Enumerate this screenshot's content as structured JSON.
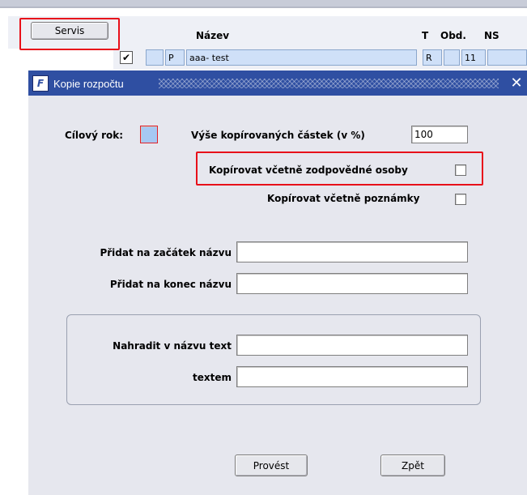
{
  "background_form": {
    "servis_button": "Servis",
    "columns": {
      "nazev": "Název",
      "t": "T",
      "obd": "Obd.",
      "ns": "NS"
    },
    "row": {
      "checked": "✔",
      "type_code": "P",
      "name": "aaa- test",
      "t_value": "R",
      "obd_value": "11"
    }
  },
  "dialog": {
    "title": "Kopie rozpočtu",
    "app_icon": "F",
    "close": "✕",
    "target_year_label": "Cílový rok:",
    "target_year_value": "",
    "amount_label": "Výše kopírovaných částek (v %)",
    "amount_value": "100",
    "copy_responsible_label": "Kopírovat včetně zodpovědné osoby",
    "copy_notes_label": "Kopírovat včetně poznámky",
    "prefix_label": "Přidat na začátek názvu",
    "prefix_value": "",
    "suffix_label": "Přidat na konec názvu",
    "suffix_value": "",
    "replace_label": "Nahradit v názvu text",
    "replace_value": "",
    "with_label": "textem",
    "with_value": "",
    "execute_button": "Provést",
    "back_button": "Zpět"
  },
  "colors": {
    "titlebar": "#2f4fa2",
    "dialog_bg": "#e6e7ee",
    "highlight": "#e8101a",
    "selected_cell": "#cfe0f8"
  }
}
